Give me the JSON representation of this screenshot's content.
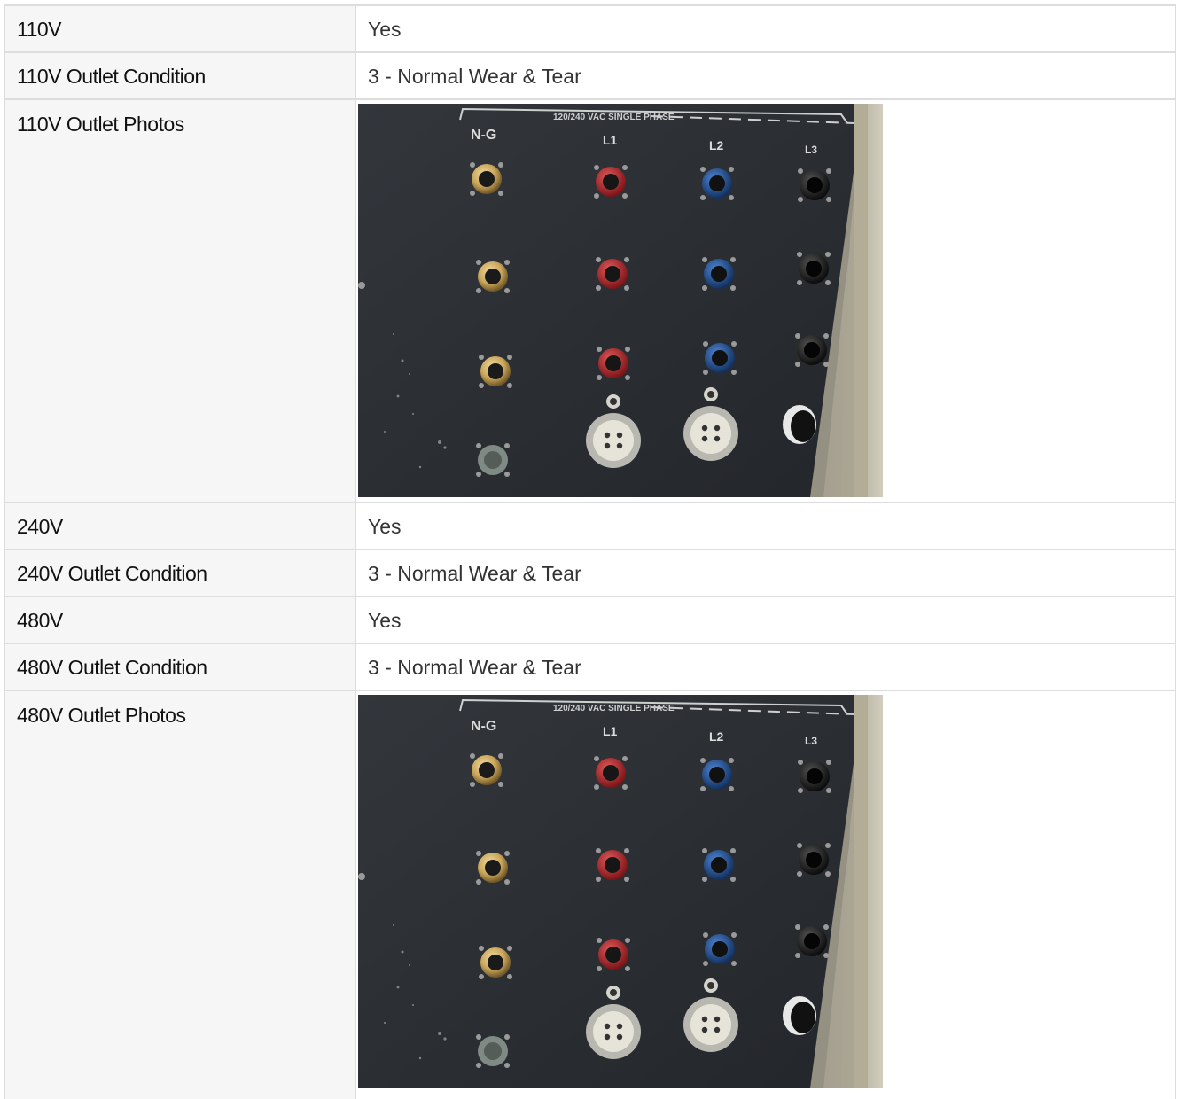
{
  "rows": [
    {
      "label": "110V",
      "value": "Yes"
    },
    {
      "label": "110V Outlet Condition",
      "value": "3 - Normal Wear & Tear"
    },
    {
      "label": "110V Outlet Photos"
    },
    {
      "label": "240V",
      "value": "Yes"
    },
    {
      "label": "240V Outlet Condition",
      "value": "3 - Normal Wear & Tear"
    },
    {
      "label": "480V",
      "value": "Yes"
    },
    {
      "label": "480V Outlet Condition",
      "value": "3 - Normal Wear & Tear"
    },
    {
      "label": "480V Outlet Photos"
    }
  ],
  "photo": {
    "panel_text": "120/240 VAC SINGLE PHASE",
    "columns": [
      "N-G",
      "L1",
      "L2",
      "L3"
    ]
  },
  "colors": {
    "panel": "#2b2e33",
    "brass": "#c9a55a",
    "red": "#b8262b",
    "blue": "#1f4f96",
    "black": "#1b1b1b",
    "grey_connector": "#c9c9c3"
  }
}
